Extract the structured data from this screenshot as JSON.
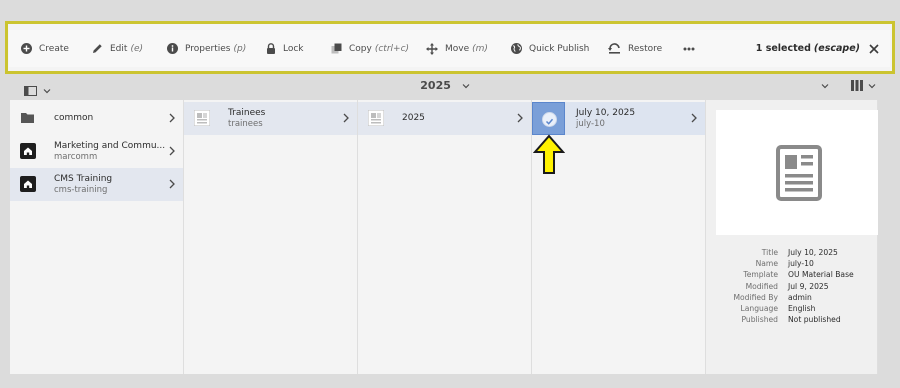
{
  "actions": [
    {
      "id": "create",
      "label": "Create",
      "shortcut": "",
      "icon": "plus-circle-icon"
    },
    {
      "id": "edit",
      "label": "Edit",
      "shortcut": "(e)",
      "icon": "pencil-icon"
    },
    {
      "id": "properties",
      "label": "Properties",
      "shortcut": "(p)",
      "icon": "info-icon"
    },
    {
      "id": "lock",
      "label": "Lock",
      "shortcut": "",
      "icon": "lock-icon"
    },
    {
      "id": "copy",
      "label": "Copy",
      "shortcut": "(ctrl+c)",
      "icon": "copy-icon"
    },
    {
      "id": "move",
      "label": "Move",
      "shortcut": "(m)",
      "icon": "move-icon"
    },
    {
      "id": "quickpublish",
      "label": "Quick Publish",
      "shortcut": "",
      "icon": "globe-icon"
    },
    {
      "id": "restore",
      "label": "Restore",
      "shortcut": "",
      "icon": "restore-icon"
    }
  ],
  "selection": {
    "count_label": "1 selected",
    "escape_label": "(escape)"
  },
  "subbar": {
    "title": "2025"
  },
  "columns": {
    "col1": [
      {
        "title": "common",
        "subtitle": "",
        "icon": "folder-icon"
      },
      {
        "title": "Marketing and Commu...",
        "subtitle": "marcomm",
        "icon": "site-icon"
      },
      {
        "title": "CMS Training",
        "subtitle": "cms-training",
        "icon": "site-icon"
      }
    ],
    "col2": [
      {
        "title": "Trainees",
        "subtitle": "trainees",
        "icon": "page-icon"
      }
    ],
    "col3": [
      {
        "title": "2025",
        "subtitle": "",
        "icon": "page-icon"
      }
    ],
    "col4": [
      {
        "title": "July 10, 2025",
        "subtitle": "july-10",
        "icon": "check-icon"
      }
    ]
  },
  "details": {
    "rows": [
      {
        "key": "Title",
        "value": "July 10, 2025"
      },
      {
        "key": "Name",
        "value": "july-10"
      },
      {
        "key": "Template",
        "value": "OU Material Base"
      },
      {
        "key": "Modified",
        "value": "Jul 9, 2025"
      },
      {
        "key": "Modified By",
        "value": "admin"
      },
      {
        "key": "Language",
        "value": "English"
      },
      {
        "key": "Published",
        "value": "Not published"
      }
    ]
  },
  "colors": {
    "highlight": "#cbc430",
    "selected": "#7a9fd8",
    "arrow": "#fff200"
  }
}
